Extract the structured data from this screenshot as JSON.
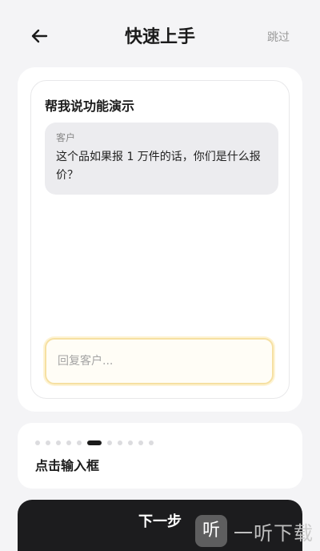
{
  "header": {
    "back_icon": "arrow-left-icon",
    "title": "快速上手",
    "skip_label": "跳过"
  },
  "demo": {
    "title": "帮我说功能演示",
    "message": {
      "sender": "客户",
      "text": "这个品如果报 1 万件的话，你们是什么报价？"
    },
    "reply_placeholder": "回复客户..."
  },
  "steps": {
    "total": 11,
    "current": 6,
    "label": "点击输入框"
  },
  "footer": {
    "next_label": "下一步"
  },
  "watermark": {
    "logo_glyph": "听",
    "text": "一听下载"
  },
  "colors": {
    "background": "#f4f4f6",
    "accent_dark": "#1c1c1e",
    "input_highlight": "#f6e0a2"
  }
}
